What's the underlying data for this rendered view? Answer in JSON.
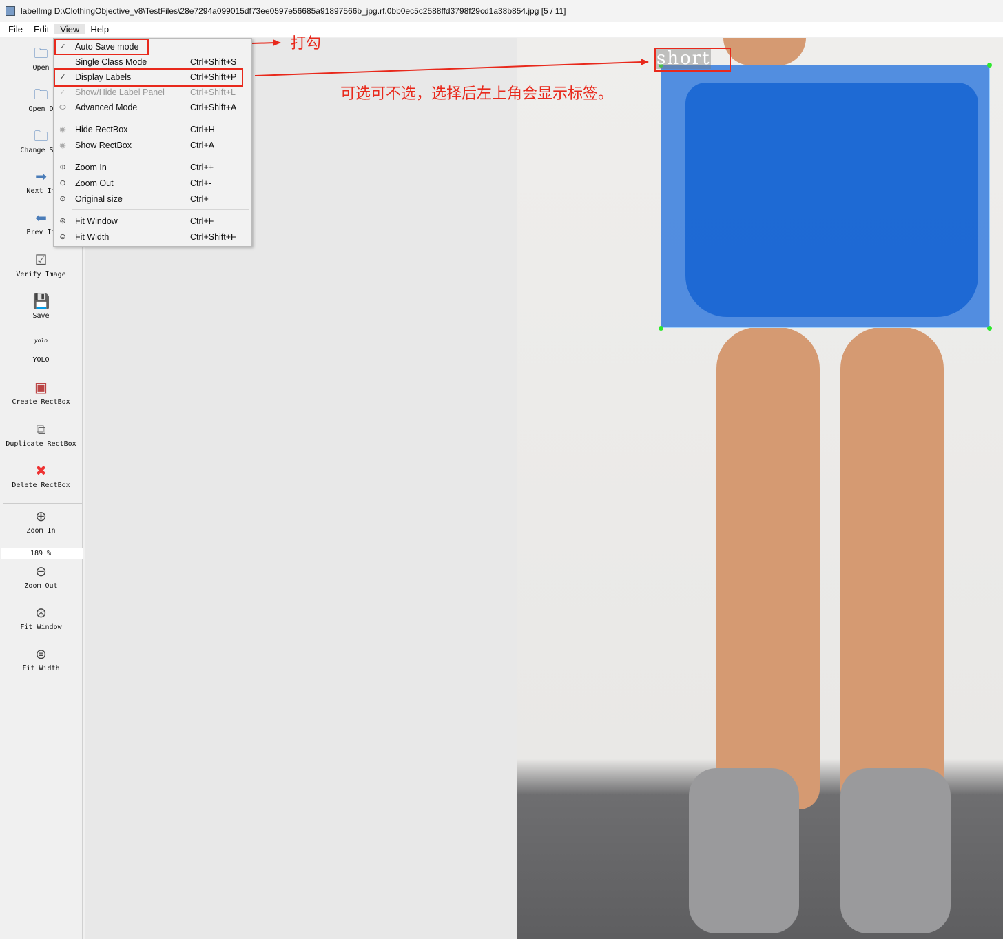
{
  "window": {
    "title": "labelImg D:\\ClothingObjective_v8\\TestFiles\\28e7294a099015df73ee0597e56685a91897566b_jpg.rf.0bb0ec5c2588ffd3798f29cd1a38b854.jpg [5 / 11]"
  },
  "menubar": [
    "File",
    "Edit",
    "View",
    "Help"
  ],
  "toolbar": {
    "open": "Open",
    "open_dir": "Open D",
    "change_save": "Change Sav",
    "next": "Next Im",
    "prev": "Prev Im",
    "verify": "Verify Image",
    "save": "Save",
    "yolo_icon": "yolo",
    "yolo": "YOLO",
    "create": "Create RectBox",
    "duplicate": "Duplicate RectBox",
    "delete": "Delete RectBox",
    "zoom_in": "Zoom In",
    "zoom_value": "189 %",
    "zoom_out": "Zoom Out",
    "fit_window": "Fit Window",
    "fit_width": "Fit Width"
  },
  "view_menu": [
    {
      "label": "Auto Save mode",
      "shortcut": "",
      "checked": true
    },
    {
      "label": "Single Class Mode",
      "shortcut": "Ctrl+Shift+S",
      "checked": false
    },
    {
      "label": "Display Labels",
      "shortcut": "Ctrl+Shift+P",
      "checked": true
    },
    {
      "label": "Show/Hide Label Panel",
      "shortcut": "Ctrl+Shift+L",
      "checked": true,
      "disabled": true
    },
    {
      "label": "Advanced Mode",
      "shortcut": "Ctrl+Shift+A"
    },
    {
      "label": "Hide RectBox",
      "shortcut": "Ctrl+H"
    },
    {
      "label": "Show RectBox",
      "shortcut": "Ctrl+A"
    },
    {
      "label": "Zoom In",
      "shortcut": "Ctrl++"
    },
    {
      "label": "Zoom Out",
      "shortcut": "Ctrl+-"
    },
    {
      "label": "Original size",
      "shortcut": "Ctrl+="
    },
    {
      "label": "Fit Window",
      "shortcut": "Ctrl+F"
    },
    {
      "label": "Fit Width",
      "shortcut": "Ctrl+Shift+F"
    }
  ],
  "canvas": {
    "box_label": "short",
    "box_color": "#1e6edc"
  },
  "annotations": {
    "check": "打勾",
    "note": "可选可不选，选择后左上角会显示标签。",
    "color": "#e8291c"
  }
}
